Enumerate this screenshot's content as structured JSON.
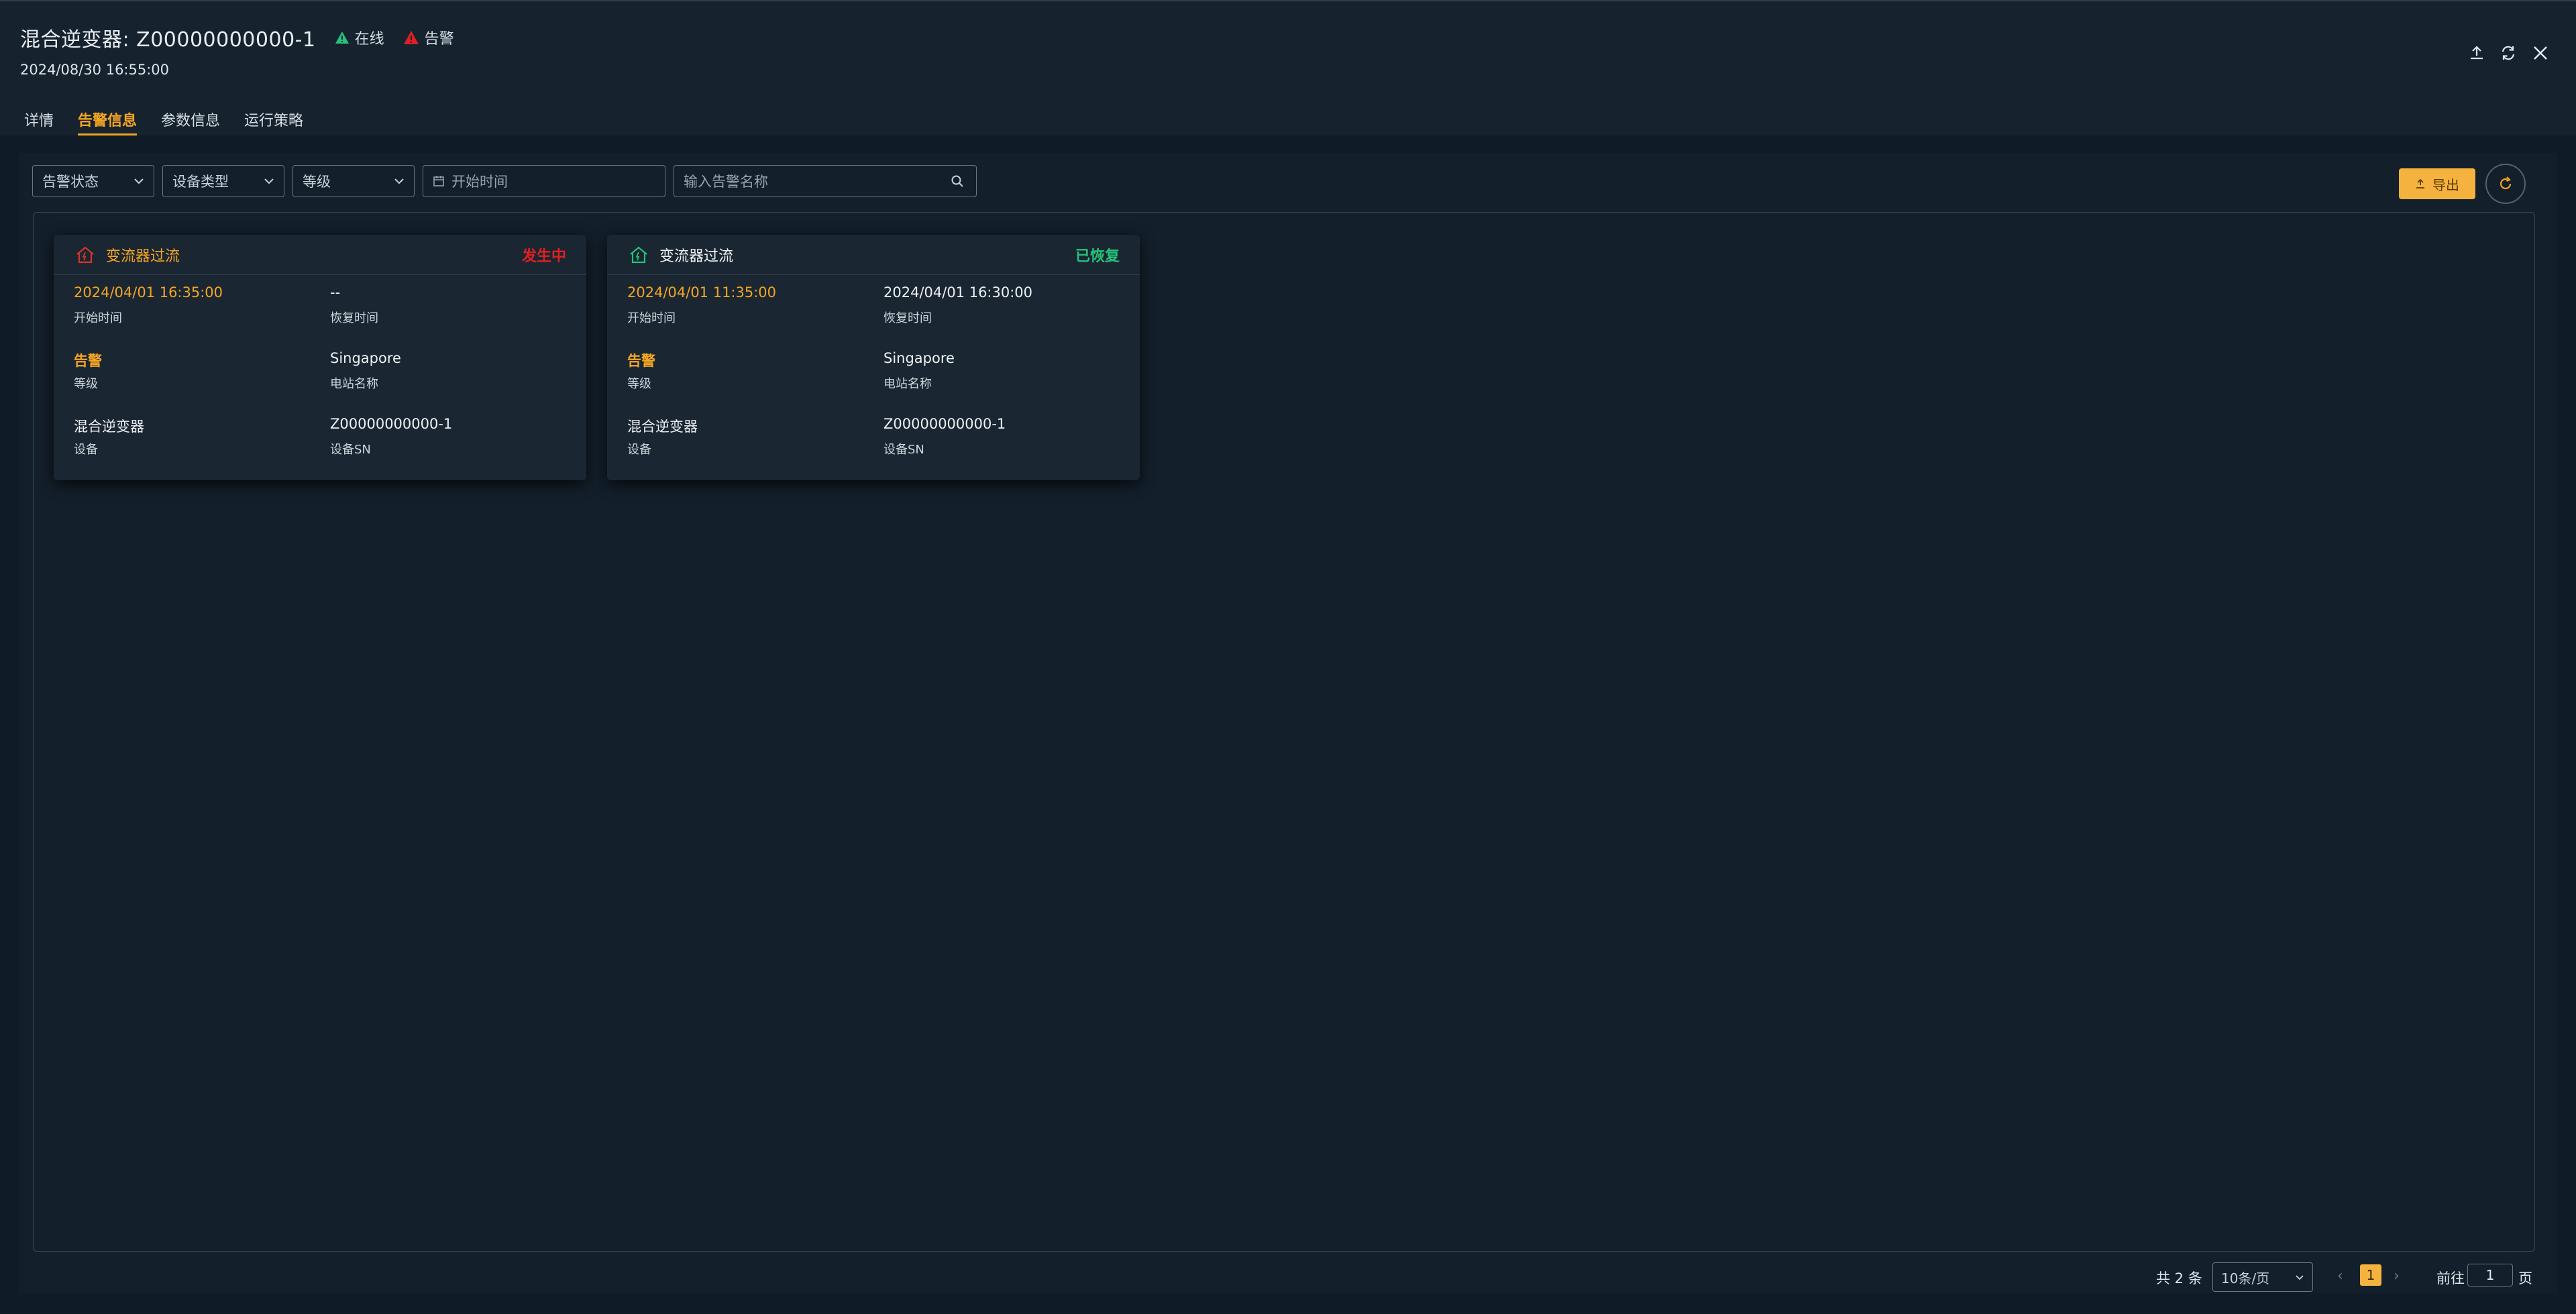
{
  "header": {
    "title": "混合逆变器: Z00000000000-1",
    "status_online": "在线",
    "status_alarm": "告警",
    "datetime": "2024/08/30 16:55:00"
  },
  "tabs": [
    {
      "label": "详情",
      "active": false
    },
    {
      "label": "告警信息",
      "active": true
    },
    {
      "label": "参数信息",
      "active": false
    },
    {
      "label": "运行策略",
      "active": false
    }
  ],
  "filters": {
    "alarm_status": "告警状态",
    "device_type": "设备类型",
    "level": "等级",
    "start_time_placeholder": "开始时间",
    "search_placeholder": "输入告警名称"
  },
  "toolbar": {
    "export_label": "导出"
  },
  "cards": [
    {
      "name": "变流器过流",
      "status": "发生中",
      "status_color": "#e02020",
      "icon_color": "#d9342b",
      "start_time": "2024/04/01 16:35:00",
      "start_time_label": "开始时间",
      "recover_time": "--",
      "recover_time_label": "恢复时间",
      "level": "告警",
      "level_label": "等级",
      "station": "Singapore",
      "station_label": "电站名称",
      "device": "混合逆变器",
      "device_label": "设备",
      "sn": "Z00000000000-1",
      "sn_label": "设备SN"
    },
    {
      "name": "变流器过流",
      "status": "已恢复",
      "status_color": "#27c27a",
      "icon_color": "#27c27a",
      "start_time": "2024/04/01 11:35:00",
      "start_time_label": "开始时间",
      "recover_time": "2024/04/01 16:30:00",
      "recover_time_label": "恢复时间",
      "level": "告警",
      "level_label": "等级",
      "station": "Singapore",
      "station_label": "电站名称",
      "device": "混合逆变器",
      "device_label": "设备",
      "sn": "Z00000000000-1",
      "sn_label": "设备SN"
    }
  ],
  "pagination": {
    "total": "共 2 条",
    "page_size": "10条/页",
    "current_page": "1",
    "goto_label": "前往",
    "goto_value": "1",
    "page_word": "页"
  },
  "colors": {
    "accent": "#f5a623",
    "online": "#27c27a",
    "alarm": "#e02020",
    "background": "#0f1b27"
  }
}
